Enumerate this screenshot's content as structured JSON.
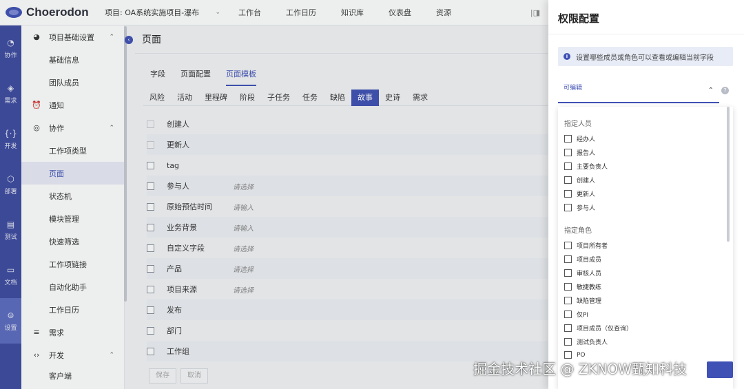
{
  "topbar": {
    "logo": "Choerodon",
    "project": "项目: OA系统实施项目-瀑布",
    "nav": [
      "工作台",
      "工作日历",
      "知识库",
      "仪表盘",
      "资源"
    ]
  },
  "rail": [
    {
      "label": "协作"
    },
    {
      "label": "需求"
    },
    {
      "label": "开发"
    },
    {
      "label": "部署"
    },
    {
      "label": "测试"
    },
    {
      "label": "文档"
    },
    {
      "label": "设置"
    }
  ],
  "subnav": {
    "groups": [
      {
        "label": "项目基础设置",
        "items": [
          "基础信息",
          "团队成员"
        ]
      },
      {
        "label": "通知"
      },
      {
        "label": "协作",
        "items": [
          "工作项类型",
          "页面",
          "状态机",
          "模块管理",
          "快速筛选",
          "工作项链接",
          "自动化助手",
          "工作日历"
        ]
      },
      {
        "label": "需求"
      },
      {
        "label": "开发",
        "items": [
          "客户端"
        ]
      }
    ]
  },
  "main": {
    "title": "页面",
    "tabs": [
      "字段",
      "页面配置",
      "页面模板"
    ],
    "issue_types": [
      "风险",
      "活动",
      "里程碑",
      "阶段",
      "子任务",
      "任务",
      "缺陷",
      "故事",
      "史诗",
      "需求"
    ],
    "fields": [
      {
        "name": "创建人",
        "value": ""
      },
      {
        "name": "更新人",
        "value": ""
      },
      {
        "name": "tag",
        "value": ""
      },
      {
        "name": "参与人",
        "value": "请选择"
      },
      {
        "name": "原始预估时间",
        "value": "请输入"
      },
      {
        "name": "业务背景",
        "value": "请输入"
      },
      {
        "name": "自定义字段",
        "value": "请选择"
      },
      {
        "name": "产品",
        "value": "请选择"
      },
      {
        "name": "项目来源",
        "value": "请选择"
      },
      {
        "name": "发布",
        "value": ""
      },
      {
        "name": "部门",
        "value": ""
      },
      {
        "name": "工作组",
        "value": ""
      }
    ],
    "buttons": {
      "save": "保存",
      "cancel": "取消"
    }
  },
  "drawer": {
    "title": "权限配置",
    "info": "设置哪些成员或角色可以查看或编辑当前字段",
    "select_label": "可编辑",
    "section_people": "指定人员",
    "people": [
      "经办人",
      "报告人",
      "主要负责人",
      "创建人",
      "更新人",
      "参与人"
    ],
    "section_roles": "指定角色",
    "roles": [
      "项目所有者",
      "项目成员",
      "审核人员",
      "敏捷教练",
      "缺陷管理",
      "仅PI",
      "项目成员（仅查询）",
      "测试负责人",
      "PO"
    ]
  },
  "watermark": "掘金技术社区 @ ZKNOW甄知科技",
  "colors": {
    "primary": "#3f51b5",
    "rail": "#3d4aa0"
  }
}
